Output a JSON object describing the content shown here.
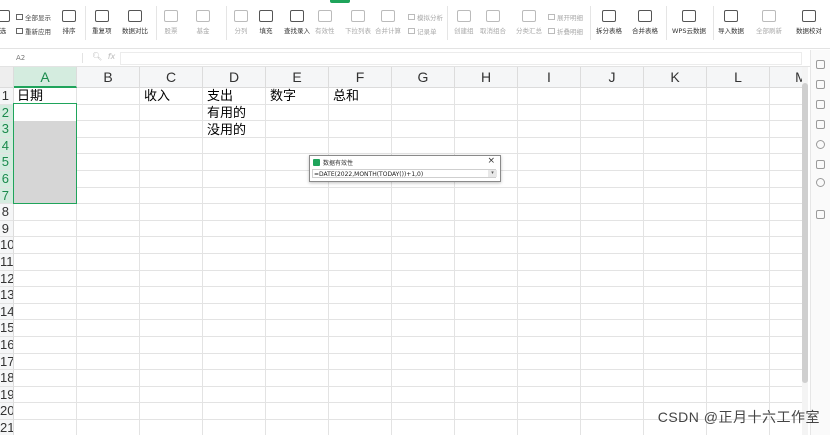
{
  "ribbon": {
    "buttons": {
      "filter": "选",
      "sort": "排序",
      "duplicates": "重复项",
      "compare": "数据对比",
      "stock": "股票",
      "fund": "基金",
      "split": "分列",
      "fill": "填充",
      "find_entry": "查找录入",
      "validity": "有效性",
      "dropdown_list": "下拉列表",
      "merge_calc": "合并计算",
      "create_group": "创建组",
      "ungroup": "取消组合",
      "subtotal": "分类汇总",
      "split_sheet": "拆分表格",
      "merge_sheet": "合并表格",
      "wps_cloud": "WPS云数据",
      "import_data": "导入数据",
      "refresh_all": "全部刷新",
      "data_proofread": "数据校对"
    },
    "small": {
      "show_all": "全部显示",
      "reapply": "重新应用",
      "simulation": "模拟分析",
      "record_sheet": "记录单",
      "expand_detail": "展开明细",
      "collapse_detail": "折叠明细"
    }
  },
  "formula_bar": {
    "cell_ref": "A2",
    "fx": "fx",
    "value": ""
  },
  "columns": [
    "A",
    "B",
    "C",
    "D",
    "E",
    "F",
    "G",
    "H",
    "I",
    "J",
    "K",
    "L",
    "M"
  ],
  "rows": [
    "1",
    "2",
    "3",
    "4",
    "5",
    "6",
    "7",
    "8",
    "9",
    "10",
    "11",
    "12",
    "13",
    "14",
    "15",
    "16",
    "17",
    "18",
    "19",
    "20",
    "21"
  ],
  "cells": {
    "a1": "日期",
    "c1": "收入",
    "d1": "支出",
    "e1": "数字",
    "f1": "总和",
    "d2": "有用的",
    "d3": "没用的"
  },
  "validation_popup": {
    "title": "数据有效性",
    "close": "×",
    "formula": "=DATE(2022,MONTH(TODAY())+1,0)"
  },
  "watermark": "CSDN @正月十六工作室"
}
